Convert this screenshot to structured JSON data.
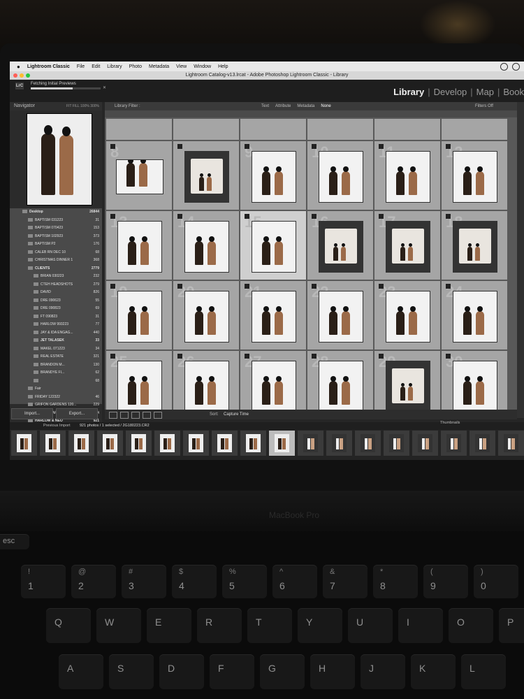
{
  "menubar": {
    "app_name": "Lightroom Classic",
    "items": [
      "File",
      "Edit",
      "Library",
      "Photo",
      "Metadata",
      "View",
      "Window",
      "Help"
    ]
  },
  "window": {
    "title": "Lightroom Catalog-v13.lrcat - Adobe Photoshop Lightroom Classic - Library"
  },
  "activity": {
    "label": "Fetching Initial Previews",
    "progress": 0.6
  },
  "modules": {
    "items": [
      "Library",
      "Develop",
      "Map",
      "Book"
    ],
    "active": "Library"
  },
  "navigator": {
    "title": "Navigator",
    "zoom": "FIT  FILL  100%  300%"
  },
  "folders": [
    {
      "name": "Desktop",
      "count": "26844",
      "bold": true
    },
    {
      "name": "BAPTISM 031223",
      "count": "31"
    },
    {
      "name": "BAPTISM 070423",
      "count": "153"
    },
    {
      "name": "BAPTISM 102923",
      "count": "373"
    },
    {
      "name": "BAPTISM P2",
      "count": "176"
    },
    {
      "name": "CALEB RN DEC 10",
      "count": "68"
    },
    {
      "name": "CHRISTMAS DINNER 1",
      "count": "368"
    },
    {
      "name": "CLIENTS",
      "count": "2779",
      "bold": true
    },
    {
      "name": "BRIAN 030223",
      "count": "232"
    },
    {
      "name": "CTEH HEADSHOTS",
      "count": "279"
    },
    {
      "name": "DAVID",
      "count": "826"
    },
    {
      "name": "DRE 090623",
      "count": "55"
    },
    {
      "name": "DRE 090823",
      "count": "69"
    },
    {
      "name": "FT 090823",
      "count": "31"
    },
    {
      "name": "HARLOW 993223",
      "count": "77"
    },
    {
      "name": "JAY & IDA ENGAG...",
      "count": "440"
    },
    {
      "name": "JET TALASEK",
      "count": "33",
      "bold": true
    },
    {
      "name": "MAKEL 071223",
      "count": "34"
    },
    {
      "name": "REAL ESTATE",
      "count": "321"
    },
    {
      "name": "BRANDON M...",
      "count": "130"
    },
    {
      "name": "BRANDYE FI...",
      "count": "62"
    },
    {
      "name": "",
      "count": "68"
    },
    {
      "name": "Fair",
      "count": ""
    },
    {
      "name": "FRIDAY 122322",
      "count": "46"
    },
    {
      "name": "GRIFON GARDENS 120...",
      "count": "229"
    },
    {
      "name": "GRIFON GARDENS 121...",
      "count": "304"
    },
    {
      "name": "HARLOW & NEO",
      "count": "921",
      "bold": true
    }
  ],
  "left_buttons": {
    "import": "Import...",
    "export": "Export..."
  },
  "filterbar": {
    "title": "Library Filter :",
    "options": [
      "Text",
      "Attribute",
      "Metadata",
      "None"
    ],
    "active": "None",
    "filters_off": "Filters Off"
  },
  "grid": {
    "top_row_count": 6,
    "cells": [
      {
        "n": "8",
        "kind": "landscape"
      },
      {
        "n": "",
        "kind": "studio"
      },
      {
        "n": "9",
        "kind": "portrait"
      },
      {
        "n": "10",
        "kind": "portrait"
      },
      {
        "n": "11",
        "kind": "portrait"
      },
      {
        "n": "12",
        "kind": "portrait"
      },
      {
        "n": "13",
        "kind": "portrait"
      },
      {
        "n": "14",
        "kind": "portrait"
      },
      {
        "n": "15",
        "kind": "portrait",
        "selected": true
      },
      {
        "n": "16",
        "kind": "studio"
      },
      {
        "n": "17",
        "kind": "studio"
      },
      {
        "n": "18",
        "kind": "studio"
      },
      {
        "n": "19",
        "kind": "portrait"
      },
      {
        "n": "20",
        "kind": "portrait"
      },
      {
        "n": "21",
        "kind": "portrait"
      },
      {
        "n": "22",
        "kind": "portrait"
      },
      {
        "n": "23",
        "kind": "portrait"
      },
      {
        "n": "24",
        "kind": "portrait"
      },
      {
        "n": "25",
        "kind": "portrait"
      },
      {
        "n": "26",
        "kind": "portrait"
      },
      {
        "n": "27",
        "kind": "portrait"
      },
      {
        "n": "28",
        "kind": "portrait"
      },
      {
        "n": "29",
        "kind": "studio"
      },
      {
        "n": "30",
        "kind": "portrait"
      }
    ]
  },
  "toolbar": {
    "sort_label": "Sort:",
    "sort_value": "Capture Time"
  },
  "filmstrip_header": {
    "source": "Previous Import",
    "info": "921 photos / 1 selected / 2G180223.CR2",
    "thumbnails": "Thumbnails"
  },
  "filmstrip": {
    "count": 18,
    "selected_index": 9,
    "dark_from": 10
  },
  "device": {
    "label": "MacBook Pro"
  },
  "keyboard": {
    "esc": "esc",
    "numbers": [
      {
        "up": "!",
        "dn": "1"
      },
      {
        "up": "@",
        "dn": "2"
      },
      {
        "up": "#",
        "dn": "3"
      },
      {
        "up": "$",
        "dn": "4"
      },
      {
        "up": "%",
        "dn": "5"
      },
      {
        "up": "^",
        "dn": "6"
      },
      {
        "up": "&",
        "dn": "7"
      },
      {
        "up": "*",
        "dn": "8"
      },
      {
        "up": "(",
        "dn": "9"
      },
      {
        "up": ")",
        "dn": "0"
      }
    ],
    "row_q": [
      "Q",
      "W",
      "E",
      "R",
      "T",
      "Y",
      "U",
      "I",
      "O",
      "P"
    ],
    "row_a": [
      "A",
      "S",
      "D",
      "F",
      "G",
      "H",
      "J",
      "K",
      "L"
    ]
  },
  "colors": {
    "grid_bg": "#595959",
    "cell": "#a5a5a5",
    "selected_cell": "#cfcfcf",
    "accent_text": "#f0f0f0"
  }
}
